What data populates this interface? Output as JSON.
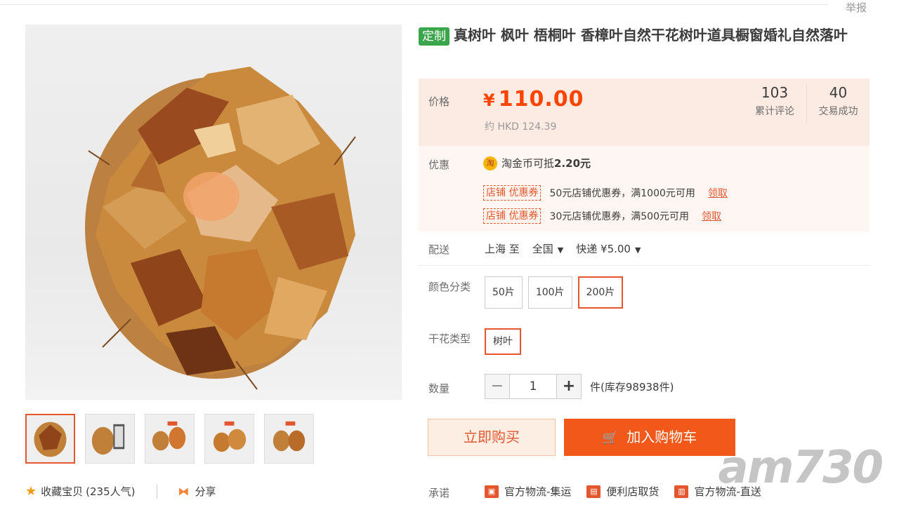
{
  "header": {
    "report": "举报"
  },
  "product": {
    "tag": "定制",
    "title": "真树叶 枫叶 梧桐叶 香樟叶自然干花树叶道具橱窗婚礼自然落叶"
  },
  "price": {
    "label": "价格",
    "currency": "¥",
    "value": "110.00",
    "hkd": "约 HKD 124.39"
  },
  "stats": [
    {
      "num": "103",
      "label": "累计评论"
    },
    {
      "num": "40",
      "label": "交易成功"
    }
  ],
  "promo": {
    "label": "优惠",
    "coin_icon": "淘",
    "coin_text": "淘金币可抵",
    "coin_amount": "2.20元",
    "coupons": [
      {
        "tag": "店铺 优惠券",
        "text": "50元店铺优惠券，满1000元可用",
        "claim": "领取"
      },
      {
        "tag": "店铺 优惠券",
        "text": "30元店铺优惠券，满500元可用",
        "claim": "领取"
      }
    ]
  },
  "shipping": {
    "label": "配送",
    "from": "上海 至",
    "to": "全国",
    "method": "快递 ¥5.00"
  },
  "color": {
    "label": "颜色分类",
    "options": [
      "50片",
      "100片",
      "200片"
    ],
    "selected": "200片"
  },
  "flower_type": {
    "label": "干花类型",
    "options": [
      "树叶"
    ],
    "selected": "树叶"
  },
  "quantity": {
    "label": "数量",
    "minus": "−",
    "value": "1",
    "plus": "+",
    "stock": "件(库存98938件)"
  },
  "actions": {
    "buy_now": "立即购买",
    "add_to_cart": "加入购物车"
  },
  "favorites": {
    "fav_label": "收藏宝贝",
    "fav_count": "(235人气)",
    "share_label": "分享"
  },
  "promise": {
    "label": "承诺",
    "items": [
      "官方物流-集运",
      "便利店取货",
      "官方物流-直送"
    ]
  },
  "watermark": "am730",
  "colors": {
    "accent": "#f40",
    "cart": "#f2581a",
    "tag": "#3aa54a"
  }
}
